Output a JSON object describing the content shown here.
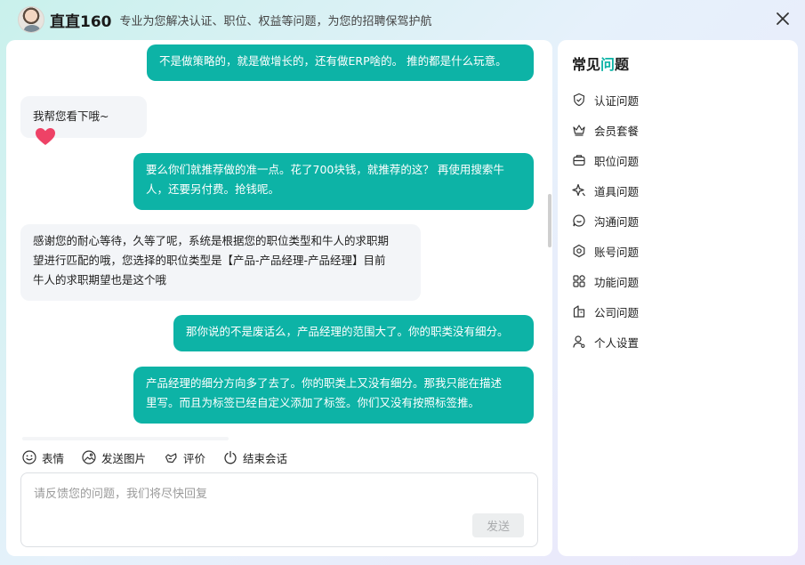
{
  "header": {
    "brand": "直直160",
    "tagline": "专业为您解决认证、职位、权益等问题，为您的招聘保驾护航"
  },
  "messages": [
    {
      "role": "user",
      "text": "不是做策略的，就是做增长的，还有做ERP啥的。 推的都是什么玩意。"
    },
    {
      "role": "bot",
      "text": "我帮您看下哦~"
    },
    {
      "role": "user",
      "lines": [
        "要么你们就推荐做的准一点。花了700块钱，就推荐的这？ 再使用搜索牛",
        "人，还要另付费。抢钱呢。"
      ]
    },
    {
      "role": "bot",
      "lines": [
        "感谢您的耐心等待，久等了呢，系统是根据您的职位类型和牛人的求职期",
        "望进行匹配的哦，您选择的职位类型是【产品-产品经理-产品经理】目前",
        "牛人的求职期望也是这个哦"
      ]
    },
    {
      "role": "user",
      "text": "那你说的不是废话么，产品经理的范围大了。你的职类没有细分。"
    },
    {
      "role": "user",
      "lines": [
        "产品经理的细分方向多了去了。你的职类上又没有细分。那我只能在描述",
        "里写。而且为标签已经自定义添加了标签。你们又没有按照标签推。"
      ]
    }
  ],
  "toolbar": {
    "emoji": "表情",
    "image": "发送图片",
    "rate": "评价",
    "end": "结束会话"
  },
  "input": {
    "placeholder": "请反馈您的问题，我们将尽快回复",
    "value": "",
    "send": "发送"
  },
  "faq": {
    "title_prefix": "常见",
    "title_accent": "问",
    "title_suffix": "题",
    "items": [
      {
        "label": "认证问题",
        "icon": "shield-icon"
      },
      {
        "label": "会员套餐",
        "icon": "crown-icon"
      },
      {
        "label": "职位问题",
        "icon": "briefcase-icon"
      },
      {
        "label": "道具问题",
        "icon": "sparkle-icon"
      },
      {
        "label": "沟通问题",
        "icon": "chat-icon"
      },
      {
        "label": "账号问题",
        "icon": "account-icon"
      },
      {
        "label": "功能问题",
        "icon": "grid-icon"
      },
      {
        "label": "公司问题",
        "icon": "building-icon"
      },
      {
        "label": "个人设置",
        "icon": "person-icon"
      }
    ]
  },
  "colors": {
    "accent": "#0db3a6",
    "bot_bubble": "#f3f5f8",
    "heart": "#ee4266"
  }
}
